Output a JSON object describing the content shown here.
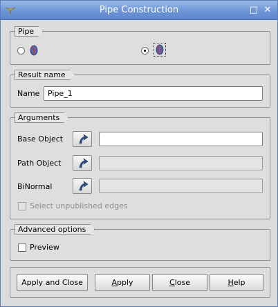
{
  "window": {
    "title": "Pipe Construction",
    "maximize_glyph": "□",
    "close_glyph": "✕"
  },
  "pipe_group": {
    "title": "Pipe",
    "options": [
      {
        "icon": "pipe-shape-icon",
        "selected": false
      },
      {
        "icon": "pipe-shape-binormal-icon",
        "selected": true
      }
    ]
  },
  "result_group": {
    "title": "Result name",
    "name_label": "Name",
    "name_value": "Pipe_1"
  },
  "arguments_group": {
    "title": "Arguments",
    "rows": [
      {
        "label": "Base Object",
        "value": "",
        "enabled": true
      },
      {
        "label": "Path Object",
        "value": "",
        "enabled": false
      },
      {
        "label": "BiNormal",
        "value": "",
        "enabled": false
      }
    ],
    "unpublished_edges_label": "Select unpublished edges"
  },
  "advanced_group": {
    "title": "Advanced options",
    "preview_label": "Preview"
  },
  "buttons": {
    "apply_close": "Apply and Close",
    "apply_first": "A",
    "apply_rest": "pply",
    "close_first": "C",
    "close_rest": "lose",
    "help_first": "H",
    "help_rest": "elp"
  }
}
